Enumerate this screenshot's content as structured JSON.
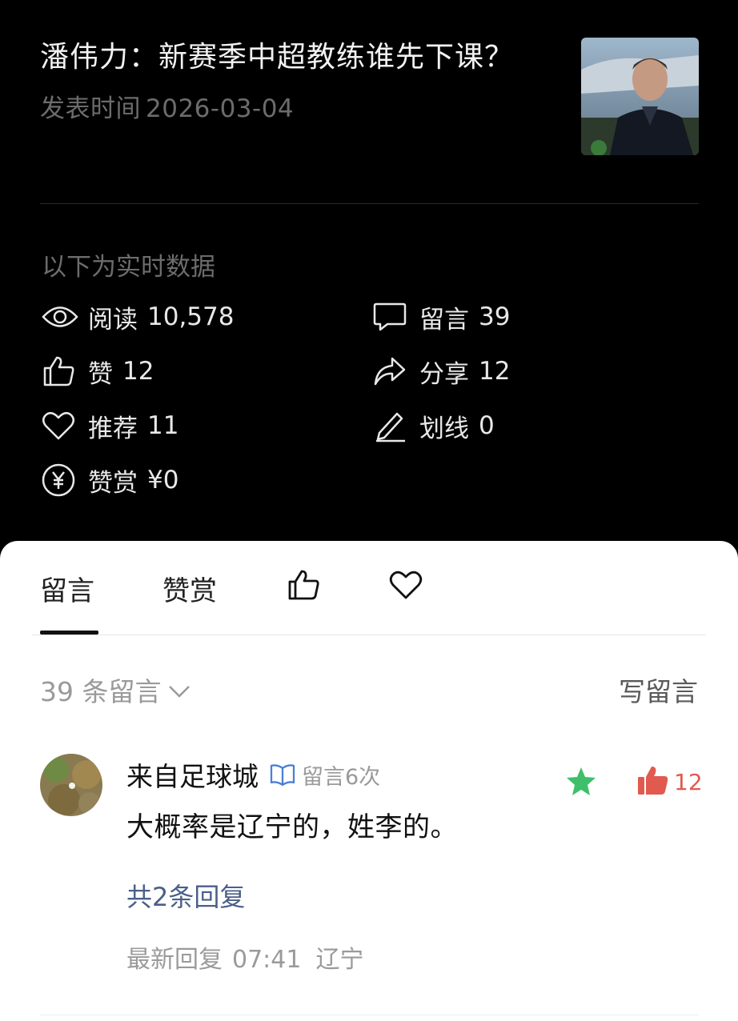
{
  "article": {
    "title": "潘伟力：新赛季中超教练谁先下课？",
    "publish_label": "发表时间",
    "publish_date": "2026-03-04"
  },
  "stats": {
    "caption": "以下为实时数据",
    "items": [
      {
        "icon": "eye-icon",
        "label": "阅读",
        "value": "10,578"
      },
      {
        "icon": "comment-icon",
        "label": "留言",
        "value": "39"
      },
      {
        "icon": "thumbs-up-icon",
        "label": "赞",
        "value": "12"
      },
      {
        "icon": "share-icon",
        "label": "分享",
        "value": "12"
      },
      {
        "icon": "heart-icon",
        "label": "推荐",
        "value": "11"
      },
      {
        "icon": "pen-icon",
        "label": "划线",
        "value": "0"
      },
      {
        "icon": "yuan-icon",
        "label": "赞赏",
        "value": "¥0"
      }
    ]
  },
  "tabs": {
    "comments": "留言",
    "rewards": "赞赏",
    "likes_icon": "thumbs-up-icon",
    "recommend_icon": "heart-icon"
  },
  "comments_section": {
    "count_label": "39 条留言",
    "write_label": "写留言"
  },
  "comment": {
    "author": "来自足球城",
    "badge_icon": "book-icon",
    "author_stat": "留言6次",
    "text": "大概率是辽宁的，姓李的。",
    "like_count": "12",
    "replies": "共2条回复",
    "latest_label": "最新回复",
    "latest_time": "07:41",
    "latest_location": "辽宁"
  },
  "colors": {
    "background_dark": "#000000",
    "sheet": "#ffffff",
    "star_green": "#3fbf6a",
    "like_red": "#e05a4f",
    "link_blue": "#4a5f8a"
  }
}
